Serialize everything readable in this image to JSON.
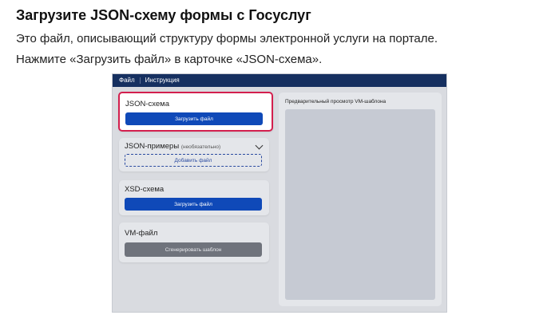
{
  "heading": "Загрузите JSON-схему формы с Госуслуг",
  "paragraph": {
    "line1": "Это файл, описывающий структуру формы электронной услуги на портале.",
    "line2": "Нажмите «Загрузить файл» в карточке «JSON-схема»."
  },
  "app": {
    "menu": {
      "file": "Файл",
      "instructions": "Инструкция"
    },
    "cards": {
      "json_schema": {
        "title": "JSON-схема",
        "button": "Загрузить файл"
      },
      "json_examples": {
        "title": "JSON-примеры",
        "optional": "(необязательно)",
        "button": "Добавить файл"
      },
      "xsd_schema": {
        "title": "XSD-схема",
        "button": "Загрузить файл"
      },
      "vm_file": {
        "title": "VM-файл",
        "button": "Сгенерировать шаблон"
      }
    },
    "preview": {
      "title": "Предварительный просмотр VM-шаблона"
    }
  },
  "colors": {
    "menubar": "#163060",
    "primary_button": "#0f49b8",
    "highlight_border": "#d31f4e",
    "disabled_button": "#6f737c"
  }
}
